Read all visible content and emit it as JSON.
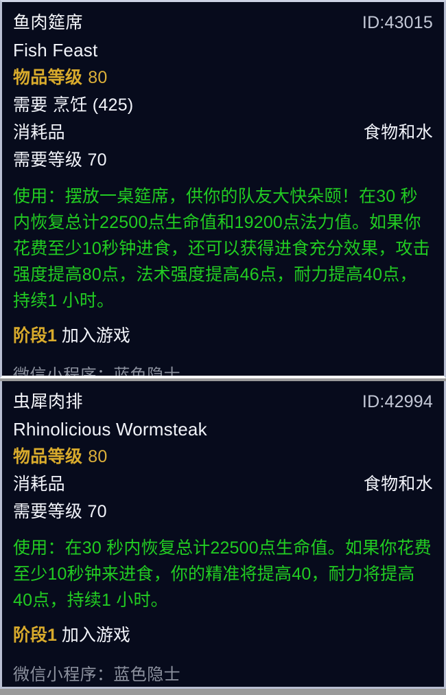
{
  "background_colors": {
    "page": "#9a9a9a",
    "tooltip_bg": "#070b1c",
    "tooltip_border": "#b9bfd2",
    "divider": "#ffffff"
  },
  "text_colors": {
    "name": "#f6f7fb",
    "english_name": "#f1f3f9",
    "item_id": "#c3c8d6",
    "gold": "#d9ab2c",
    "white": "#f2f4fa",
    "green": "#22cc22",
    "footer_gray": "#8d929f"
  },
  "tooltips": [
    {
      "id": "fish-feast",
      "name": "鱼肉筵席",
      "item_id": "ID:43015",
      "english_name": "Fish Feast",
      "item_level": {
        "label": "物品等级",
        "value": "80"
      },
      "requires_skill": "需要 烹饪 (425)",
      "category": "消耗品",
      "subcategory": "食物和水",
      "required_level": "需要等级 70",
      "use_text": "使用：摆放一桌筵席，供你的队友大快朵颐！在30 秒内恢复总计22500点生命值和19200点法力值。如果你花费至少10秒钟进食，还可以获得进食充分效果，攻击强度提高80点，法术强度提高46点，耐力提高40点，持续1 小时。",
      "phase_label": "阶段1",
      "phase_rest": " 加入游戏",
      "footer": "微信小程序：蓝色隐士"
    },
    {
      "id": "wormsteak",
      "name": "虫犀肉排",
      "item_id": "ID:42994",
      "english_name": "Rhinolicious Wormsteak",
      "item_level": {
        "label": "物品等级",
        "value": "80"
      },
      "requires_skill": null,
      "category": "消耗品",
      "subcategory": "食物和水",
      "required_level": "需要等级 70",
      "use_text": "使用：在30 秒内恢复总计22500点生命值。如果你花费至少10秒钟来进食，你的精准将提高40，耐力将提高40点，持续1 小时。",
      "phase_label": "阶段1",
      "phase_rest": " 加入游戏",
      "footer": "微信小程序：蓝色隐士"
    }
  ]
}
